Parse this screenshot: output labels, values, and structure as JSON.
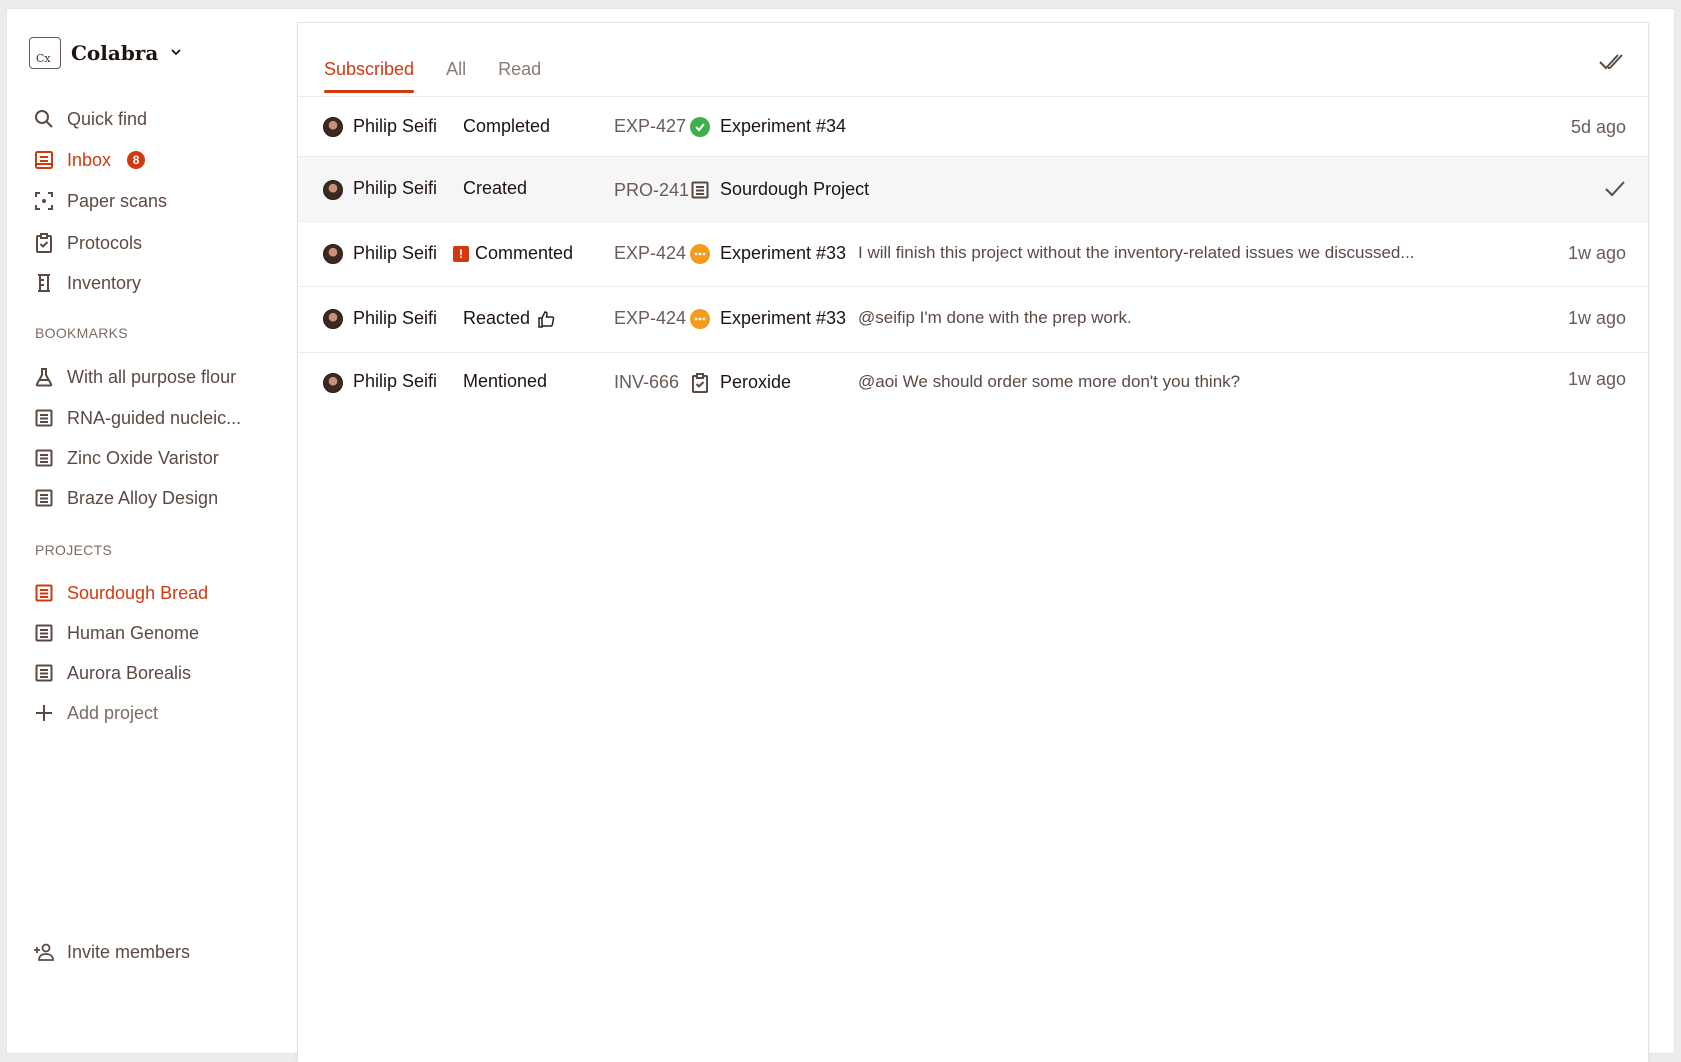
{
  "workspace": {
    "logo": "Cx",
    "name": "Colabra"
  },
  "nav": [
    {
      "label": "Quick find",
      "icon": "search-icon"
    },
    {
      "label": "Inbox",
      "icon": "inbox-icon",
      "badge": "8",
      "active": true
    },
    {
      "label": "Paper scans",
      "icon": "scan-icon"
    },
    {
      "label": "Protocols",
      "icon": "clipboard-check-icon"
    },
    {
      "label": "Inventory",
      "icon": "inventory-icon"
    }
  ],
  "bookmarks": {
    "label": "BOOKMARKS",
    "items": [
      {
        "label": "With all purpose flour",
        "icon": "flask-icon"
      },
      {
        "label": "RNA-guided nucleic...",
        "icon": "document-icon"
      },
      {
        "label": "Zinc Oxide Varistor",
        "icon": "document-icon"
      },
      {
        "label": "Braze Alloy Design",
        "icon": "document-icon"
      }
    ]
  },
  "projects": {
    "label": "PROJECTS",
    "items": [
      {
        "label": "Sourdough Bread",
        "icon": "document-icon",
        "active": true
      },
      {
        "label": "Human Genome",
        "icon": "document-icon"
      },
      {
        "label": "Aurora Borealis",
        "icon": "document-icon"
      }
    ],
    "add_label": "Add project"
  },
  "invite_label": "Invite members",
  "tabs": [
    "Subscribed",
    "All",
    "Read"
  ],
  "notifications": [
    {
      "user": "Philip Seifi",
      "action": "Completed",
      "code": "EXP-427",
      "status": "completed",
      "title": "Experiment #34",
      "message": "",
      "time": "5d ago"
    },
    {
      "user": "Philip Seifi",
      "action": "Created",
      "code": "PRO-241",
      "status": "document",
      "title": "Sourdough Project",
      "message": "",
      "time": ""
    },
    {
      "user": "Philip Seifi",
      "action": "Commented",
      "code": "EXP-424",
      "status": "in-progress",
      "title": "Experiment #33",
      "message": "I will finish this project without the inventory-related issues we discussed...",
      "time": "1w ago"
    },
    {
      "user": "Philip Seifi",
      "action": "Reacted",
      "code": "EXP-424",
      "status": "in-progress",
      "title": "Experiment #33",
      "message": "@seifip I'm done with the prep work.",
      "time": "1w ago"
    },
    {
      "user": "Philip Seifi",
      "action": "Mentioned",
      "code": "INV-666",
      "status": "protocol",
      "title": "Peroxide",
      "message": "@aoi We should order some more don't you think?",
      "time": "1w ago"
    }
  ],
  "colors": {
    "accent": "#d2390f",
    "success": "#3fae4d",
    "warning": "#f39b1b"
  }
}
